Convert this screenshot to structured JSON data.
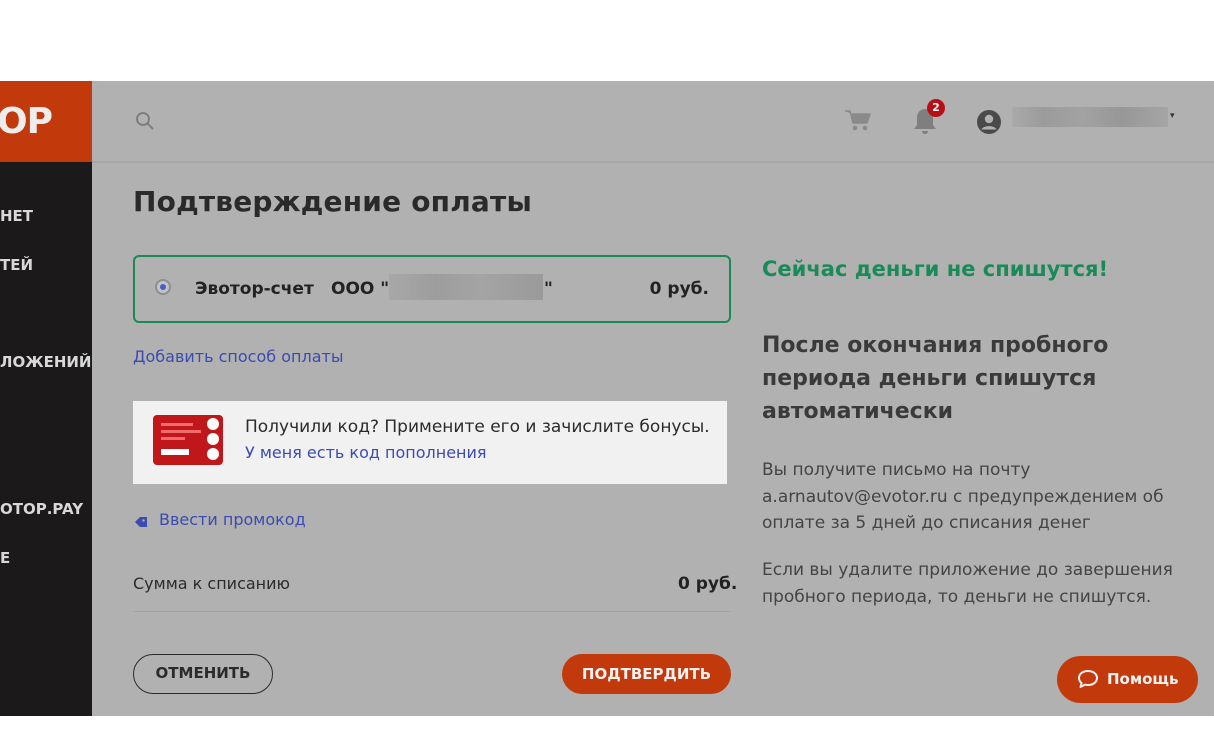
{
  "sidebar": {
    "logo": "OP",
    "items": [
      "НЕТ",
      "ТЕЙ",
      "ЛОЖЕНИЙ",
      "ОТОР.PAY",
      "Е"
    ]
  },
  "header": {
    "search_icon": "search-icon",
    "cart_icon": "cart-icon",
    "notifications_count": "2",
    "user_caret": "▾"
  },
  "page": {
    "title": "Подтверждение оплаты"
  },
  "payment_method": {
    "name": "Эвотор-счет",
    "org_prefix": "ООО \"",
    "org_suffix": "\"",
    "amount": "0 руб.",
    "selected": true
  },
  "add_payment_method": "Добавить способ оплаты",
  "bonus": {
    "text": "Получили код? Примените его и зачислите бонусы.",
    "link": "У меня есть код пополнения"
  },
  "promo": {
    "link": "Ввести промокод"
  },
  "summary": {
    "label": "Сумма к списанию",
    "value": "0 руб."
  },
  "actions": {
    "cancel": "ОТМЕНИТЬ",
    "confirm": "ПОДТВЕРДИТЬ"
  },
  "info": {
    "green_heading": "Сейчас деньги не спишутся!",
    "heading": "После окончания пробного периода деньги спишутся автоматически",
    "paragraph1": "Вы получите письмо на почту a.arnautov@evotor.ru с предупреждением об оплате за 5 дней до списания денег",
    "paragraph2": "Если вы удалите приложение до завершения пробного периода, то деньги не спишутся."
  },
  "help": {
    "label": "Помощь"
  },
  "colors": {
    "brand": "#c23a0c",
    "success": "#198a58",
    "link": "#3b4bb0",
    "overlay": "#b1b1b1",
    "sidebar": "#1b1919"
  }
}
